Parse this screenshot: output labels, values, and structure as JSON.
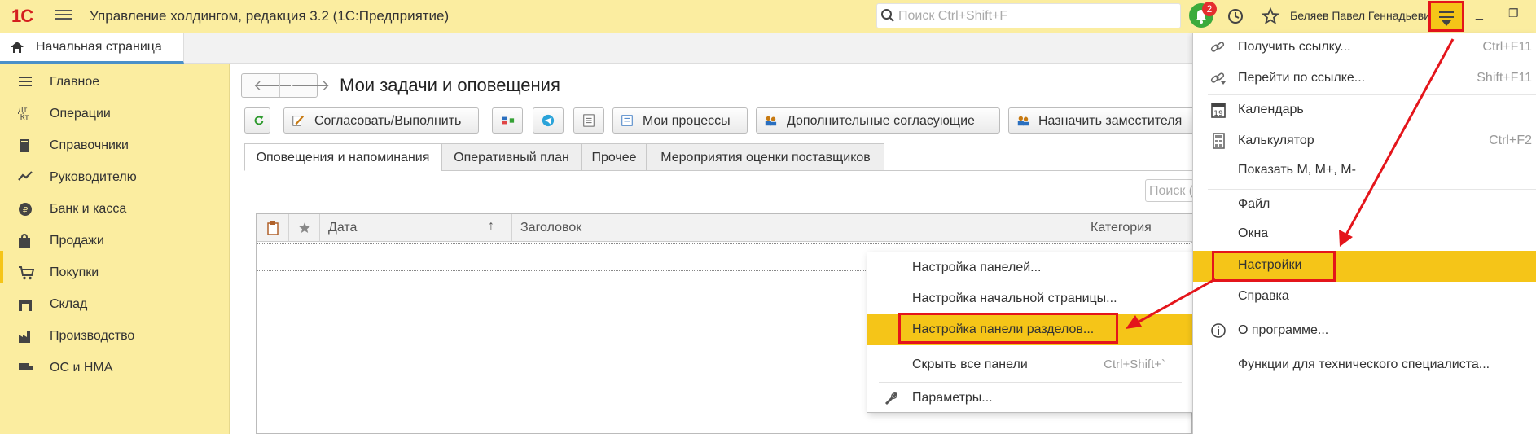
{
  "app": {
    "title": "Управление холдингом, редакция 3.2  (1С:Предприятие)",
    "search_placeholder": "Поиск Ctrl+Shift+F",
    "notifications_count": "2",
    "user_name": "Беляев Павел Геннадьевич"
  },
  "tabs": {
    "home": "Начальная страница"
  },
  "sidebar": {
    "items": [
      {
        "label": "Главное",
        "icon": "list-icon"
      },
      {
        "label": "Операции",
        "icon": "dt-kt-icon"
      },
      {
        "label": "Справочники",
        "icon": "book-icon"
      },
      {
        "label": "Руководителю",
        "icon": "chart-up-icon"
      },
      {
        "label": "Банк и касса",
        "icon": "coin-icon"
      },
      {
        "label": "Продажи",
        "icon": "bag-icon"
      },
      {
        "label": "Покупки",
        "icon": "cart-icon"
      },
      {
        "label": "Склад",
        "icon": "warehouse-icon"
      },
      {
        "label": "Производство",
        "icon": "factory-icon"
      },
      {
        "label": "ОС и НМА",
        "icon": "truck-icon"
      }
    ]
  },
  "page": {
    "title": "Мои задачи и оповещения",
    "toolbar": {
      "approve": "Согласовать/Выполнить",
      "my_processes": "Мои процессы",
      "extra_approvers": "Дополнительные согласующие",
      "assign_deputy": "Назначить заместителя"
    },
    "form_tabs": [
      "Оповещения и напоминания",
      "Оперативный план",
      "Прочее",
      "Мероприятия оценки поставщиков"
    ],
    "grid_search_placeholder": "Поиск (",
    "columns": [
      "Дата",
      "Заголовок",
      "Категория"
    ]
  },
  "submenu": {
    "items": [
      {
        "label": "Настройка панелей...",
        "shortcut": ""
      },
      {
        "label": "Настройка начальной страницы...",
        "shortcut": ""
      },
      {
        "label": "Настройка панели разделов...",
        "shortcut": ""
      },
      {
        "label": "Скрыть все панели",
        "shortcut": "Ctrl+Shift+`"
      },
      {
        "label": "Параметры...",
        "shortcut": ""
      }
    ]
  },
  "main_menu": {
    "items": [
      {
        "label": "Получить ссылку...",
        "shortcut": "Ctrl+F11"
      },
      {
        "label": "Перейти по ссылке...",
        "shortcut": "Shift+F11"
      },
      {
        "label": "Календарь",
        "shortcut": ""
      },
      {
        "label": "Калькулятор",
        "shortcut": "Ctrl+F2"
      },
      {
        "label": "Показать М, М+, М-",
        "shortcut": ""
      },
      {
        "label": "Файл",
        "shortcut": ""
      },
      {
        "label": "Окна",
        "shortcut": ""
      },
      {
        "label": "Настройки",
        "shortcut": ""
      },
      {
        "label": "Справка",
        "shortcut": ""
      },
      {
        "label": "О программе...",
        "shortcut": ""
      },
      {
        "label": "Функции для технического специалиста...",
        "shortcut": ""
      }
    ]
  },
  "colors": {
    "titlebar": "#fbeda0",
    "highlight": "#f5c518",
    "annotation_red": "#e4151b"
  }
}
